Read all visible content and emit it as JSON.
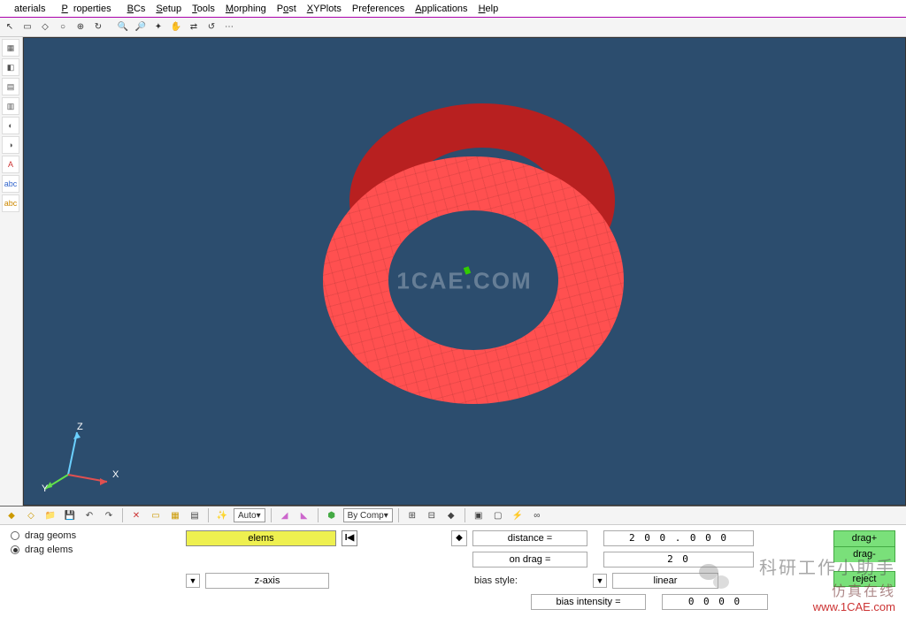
{
  "menu": {
    "items": [
      "aterials",
      "Properties",
      "BCs",
      "Setup",
      "Tools",
      "Morphing",
      "Post",
      "XYPlots",
      "Preferences",
      "Applications",
      "Help"
    ]
  },
  "toolbar2": {
    "auto": "Auto",
    "bycomp": "By Comp"
  },
  "panel": {
    "radio1": "drag geoms",
    "radio2": "drag elems",
    "elems": "elems",
    "zaxis": "z-axis",
    "distance_label": "distance =",
    "distance_value": "2 0 0 . 0 0 0",
    "ondrag_label": "on drag =",
    "ondrag_value": "2 0",
    "bias_style": "bias style:",
    "bias_linear": "linear",
    "bias_int": "bias intensity =",
    "bias_int_val": "0  0 0 0",
    "btn_drag_plus": "drag+",
    "btn_drag_minus": "drag-",
    "btn_reject": "reject"
  },
  "axis": {
    "z": "Z",
    "y": "Y",
    "x": "X"
  },
  "watermarks": {
    "center": "1CAE.COM",
    "chinese1": "科研工作小助手",
    "chinese2": "仿真在线",
    "url": "www.1CAE.com"
  }
}
